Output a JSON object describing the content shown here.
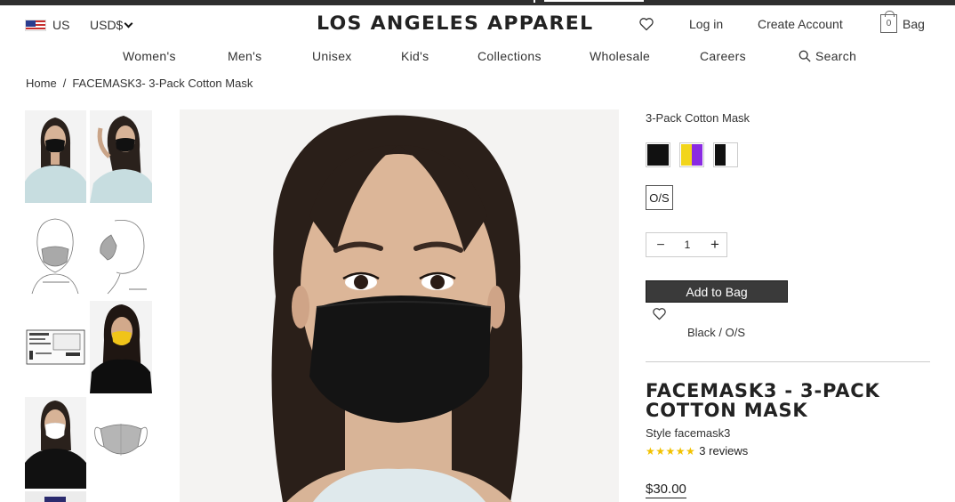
{
  "header": {
    "country": "US",
    "currency": "USD$",
    "logo": "LOS ANGELES APPAREL",
    "login": "Log in",
    "create_account": "Create Account",
    "bag_label": "Bag",
    "bag_count": "0"
  },
  "nav": {
    "items": [
      "Women's",
      "Men's",
      "Unisex",
      "Kid's",
      "Collections",
      "Wholesale",
      "Careers"
    ],
    "search": "Search"
  },
  "breadcrumb": {
    "home": "Home",
    "separator": "/",
    "current": "FACEMASK3- 3-Pack Cotton Mask"
  },
  "product": {
    "color_label": "3-Pack Cotton Mask",
    "swatches": [
      {
        "name": "Black",
        "colors": [
          "#111111",
          "#111111"
        ]
      },
      {
        "name": "Yellow / Purple",
        "colors": [
          "#f2d51b",
          "#8a2be2"
        ]
      },
      {
        "name": "Black / White",
        "colors": [
          "#111111",
          "#ffffff"
        ]
      }
    ],
    "size": "O/S",
    "quantity": "1",
    "add_to_bag": "Add to Bag",
    "selected_variant": "Black / O/S",
    "title": "FACEMASK3 - 3-PACK COTTON MASK",
    "style": "Style facemask3",
    "rating": 5,
    "reviews": "3 reviews",
    "price": "$30.00"
  },
  "colors": {
    "dark": "#3a3a3a",
    "star": "#f2c200"
  }
}
